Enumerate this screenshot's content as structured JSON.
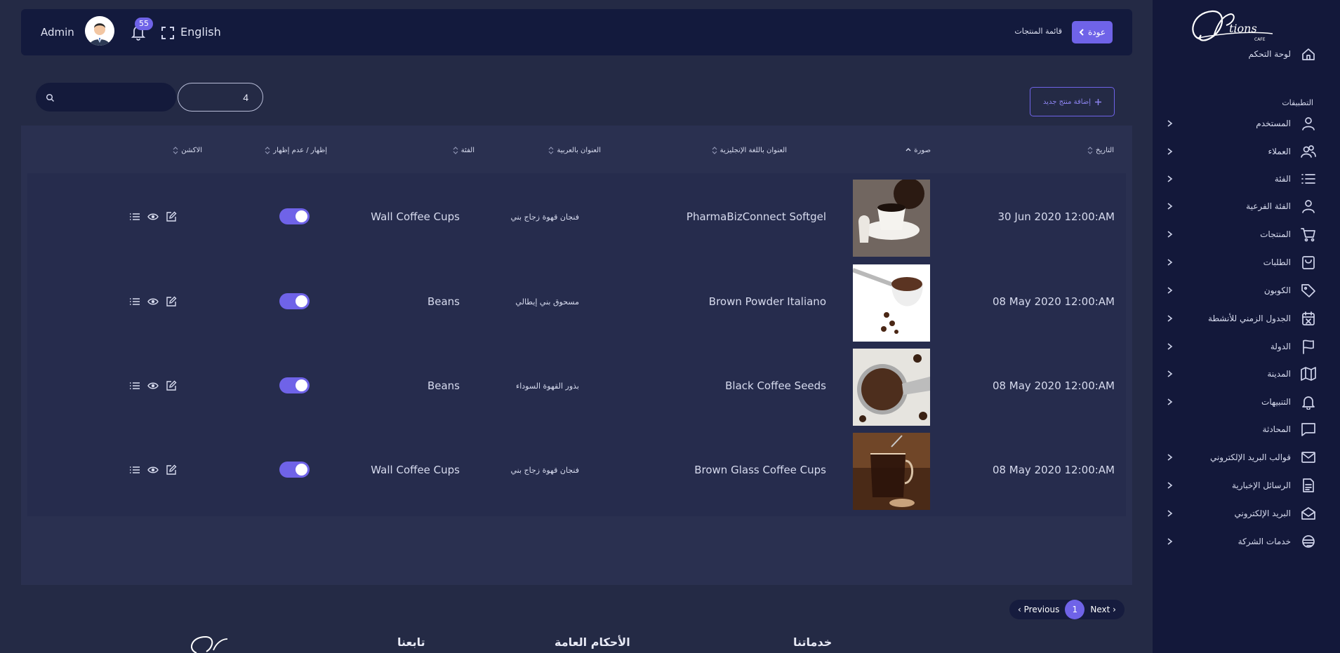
{
  "sidebar": {
    "brand": "Options Cafe",
    "section_label": "التطبيقات",
    "items": [
      {
        "label": "لوحة التحكم",
        "icon": "home-icon",
        "chevron": false
      },
      {
        "label": "المستخدم",
        "icon": "user-icon",
        "chevron": true
      },
      {
        "label": "العملاء",
        "icon": "users-icon",
        "chevron": true
      },
      {
        "label": "الفئة",
        "icon": "list-icon",
        "chevron": true
      },
      {
        "label": "الفئة الفرعية",
        "icon": "user-icon",
        "chevron": true
      },
      {
        "label": "المنتجات",
        "icon": "cart-icon",
        "chevron": true
      },
      {
        "label": "الطلبات",
        "icon": "bag-icon",
        "chevron": true
      },
      {
        "label": "الكوبون",
        "icon": "tag-icon",
        "chevron": true
      },
      {
        "label": "الجدول الزمني للأنشطة",
        "icon": "calendar-icon",
        "chevron": true
      },
      {
        "label": "الدولة",
        "icon": "flag-icon",
        "chevron": true
      },
      {
        "label": "المدينة",
        "icon": "map-icon",
        "chevron": true
      },
      {
        "label": "التنبيهات",
        "icon": "bell-icon",
        "chevron": true
      },
      {
        "label": "المحادثة",
        "icon": "chat-icon",
        "chevron": false
      },
      {
        "label": "قوالب البريد الإلكتروني",
        "icon": "mail-icon",
        "chevron": true
      },
      {
        "label": "الرسائل الإخبارية",
        "icon": "document-icon",
        "chevron": true
      },
      {
        "label": "البريد الإلكتروني",
        "icon": "mail-open-icon",
        "chevron": true
      },
      {
        "label": "خدمات الشركة",
        "icon": "services-icon",
        "chevron": true
      }
    ]
  },
  "topbar": {
    "user_name": "Admin",
    "notification_count": "55",
    "language": "English",
    "breadcrumb": "قائمة المنتجات",
    "back_label": "عودة"
  },
  "toolbar": {
    "search_value": "",
    "count_value": "4",
    "add_label": "إضافة منتج جديد"
  },
  "table": {
    "headers": {
      "date": "التاريخ",
      "image": "صورة",
      "title_en": "العنوان باللغة الإنجليزية",
      "title_ar": "العنوان بالعربية",
      "category": "الفئة",
      "visibility": "إظهار / عدم إظهار",
      "actions": "الاكشن"
    },
    "rows": [
      {
        "date": "30 Jun 2020 12:00:AM",
        "image": "coffee-cup-photo",
        "title_en": "PharmaBizConnect Softgel",
        "title_ar": "فنجان قهوة زجاج بني",
        "category": "Wall Coffee Cups",
        "visible": true
      },
      {
        "date": "08 May 2020 12:00:AM",
        "image": "coffee-powder-photo",
        "title_en": "Brown Powder Italiano",
        "title_ar": "مسحوق بني إيطالي",
        "category": "Beans",
        "visible": true
      },
      {
        "date": "08 May 2020 12:00:AM",
        "image": "coffee-seeds-photo",
        "title_en": "Black Coffee Seeds",
        "title_ar": "بذور القهوة السوداء",
        "category": "Beans",
        "visible": true
      },
      {
        "date": "08 May 2020 12:00:AM",
        "image": "glass-coffee-photo",
        "title_en": "Brown Glass Coffee Cups",
        "title_ar": "فنجان قهوة زجاج بني",
        "category": "Wall Coffee Cups",
        "visible": true
      }
    ]
  },
  "pagination": {
    "previous": "Previous",
    "current": "1",
    "next": "Next"
  },
  "footer": {
    "services": "خدماتنا",
    "terms": "الأحكام العامة",
    "follow": "تابعنا"
  },
  "colors": {
    "accent": "#6f63e8",
    "sidebar_bg": "#13183a",
    "page_bg": "#242a45"
  }
}
